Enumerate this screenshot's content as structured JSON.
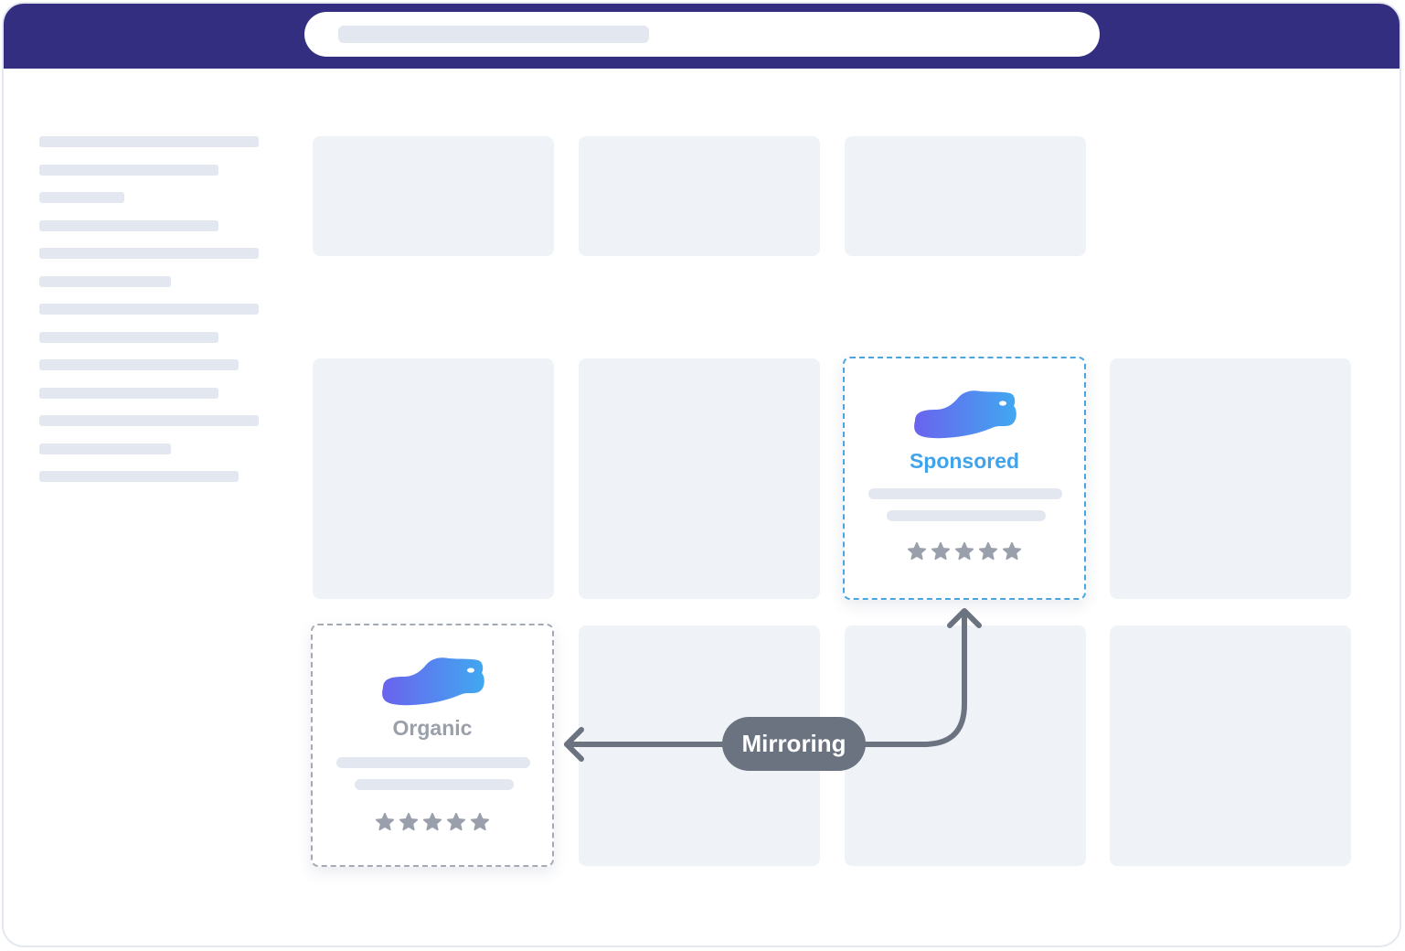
{
  "header": {
    "bar_color": "#332e80",
    "search_icon": null
  },
  "cards": {
    "sponsored": {
      "label": "Sponsored",
      "icon": "shoe-icon",
      "rating_stars": 5,
      "accent": "#41a3ea"
    },
    "organic": {
      "label": "Organic",
      "icon": "shoe-icon",
      "rating_stars": 5,
      "accent": "#9aa0ab"
    }
  },
  "connector": {
    "label": "Mirroring",
    "color": "#6b7280"
  }
}
